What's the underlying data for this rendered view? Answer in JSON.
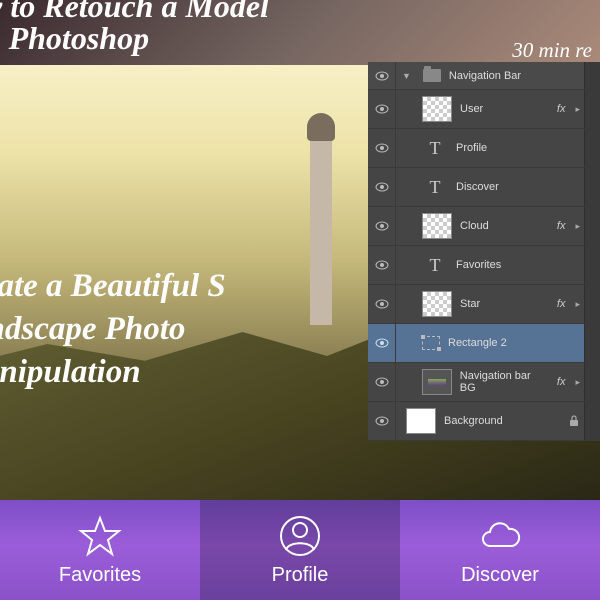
{
  "hero1": {
    "title_line1": "ow to Retouch a Model",
    "title_line2": "ith Photoshop",
    "subtitle": "30 min re"
  },
  "hero2": {
    "line1": "reate a Beautiful S",
    "line2": "andscape Photo",
    "line3": "Ianipulation"
  },
  "layers": {
    "group": "Navigation Bar",
    "items": [
      {
        "name": "User",
        "type": "checker",
        "fx": true
      },
      {
        "name": "Profile",
        "type": "text",
        "fx": false
      },
      {
        "name": "Discover",
        "type": "text",
        "fx": false
      },
      {
        "name": "Cloud",
        "type": "checker",
        "fx": true
      },
      {
        "name": "Favorites",
        "type": "text",
        "fx": false
      },
      {
        "name": "Star",
        "type": "checker",
        "fx": true
      },
      {
        "name": "Rectangle 2",
        "type": "shape",
        "fx": false,
        "selected": true
      },
      {
        "name": "Navigation bar BG",
        "type": "shape-thumb",
        "fx": true
      },
      {
        "name": "Background",
        "type": "white",
        "fx": false,
        "locked": true
      }
    ],
    "fx_label": "fx"
  },
  "nav": {
    "favorites": "Favorites",
    "profile": "Profile",
    "discover": "Discover"
  }
}
